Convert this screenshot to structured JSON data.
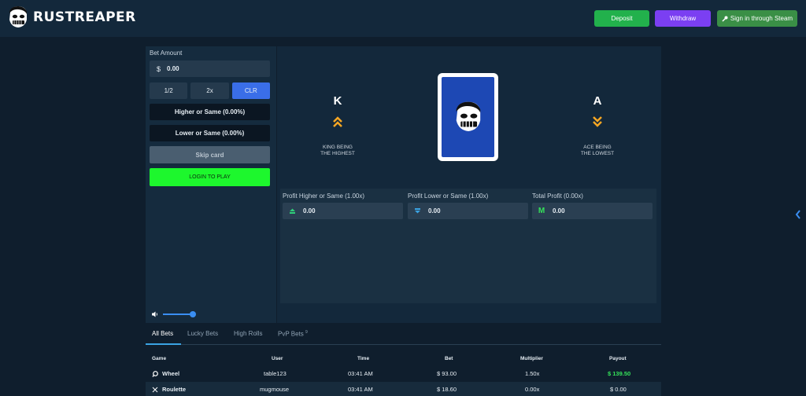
{
  "header": {
    "brand": "RUSTREAPER",
    "deposit_label": "Deposit",
    "withdraw_label": "Withdraw",
    "steam_label": "Sign in through Steam"
  },
  "bet_panel": {
    "bet_amount_label": "Bet Amount",
    "currency_symbol": "$",
    "bet_value": "0.00",
    "half_label": "1/2",
    "double_label": "2x",
    "clear_label": "CLR",
    "higher_label": "Higher or Same (0.00%)",
    "lower_label": "Lower or Same (0.00%)",
    "skip_label": "Skip card",
    "login_label": "LOGIN TO PLAY"
  },
  "game": {
    "high_letter": "K",
    "high_caption_1": "KING BEING",
    "high_caption_2": "THE HIGHEST",
    "low_letter": "A",
    "low_caption_1": "ACE BEING",
    "low_caption_2": "THE LOWEST",
    "profit_higher_label": "Profit Higher or Same (1.00x)",
    "profit_higher_value": "0.00",
    "profit_lower_label": "Profit Lower or Same (1.00x)",
    "profit_lower_value": "0.00",
    "total_profit_label": "Total Profit (0.00x)",
    "total_profit_value": "0.00",
    "total_icon_letter": "M"
  },
  "colors": {
    "deposit": "#22b14c",
    "withdraw": "#7b3ff2",
    "steam": "#3a8f46",
    "login": "#1df72d",
    "accent_blue": "#3a6ee8",
    "card_blue": "#1d48b4",
    "chevron": "#f5a623",
    "win": "#35e25a"
  },
  "volume_level": 0.9,
  "bets": {
    "tabs": [
      {
        "label": "All Bets"
      },
      {
        "label": "Lucky Bets"
      },
      {
        "label": "High Rolls"
      },
      {
        "label": "PvP Bets",
        "badge": "9"
      }
    ],
    "columns": [
      "Game",
      "User",
      "Time",
      "Bet",
      "Multiplier",
      "Payout"
    ],
    "rows": [
      {
        "game": "Wheel",
        "game_icon": "wheel-icon",
        "user": "table123",
        "time": "03:41 AM",
        "bet": "$ 93.00",
        "multiplier": "1.50x",
        "payout": "$ 139.50"
      },
      {
        "game": "Roulette",
        "game_icon": "roulette-x-icon",
        "user": "mugmouse",
        "time": "03:41 AM",
        "bet": "$ 18.60",
        "multiplier": "0.00x",
        "payout": "$ 0.00"
      }
    ]
  }
}
